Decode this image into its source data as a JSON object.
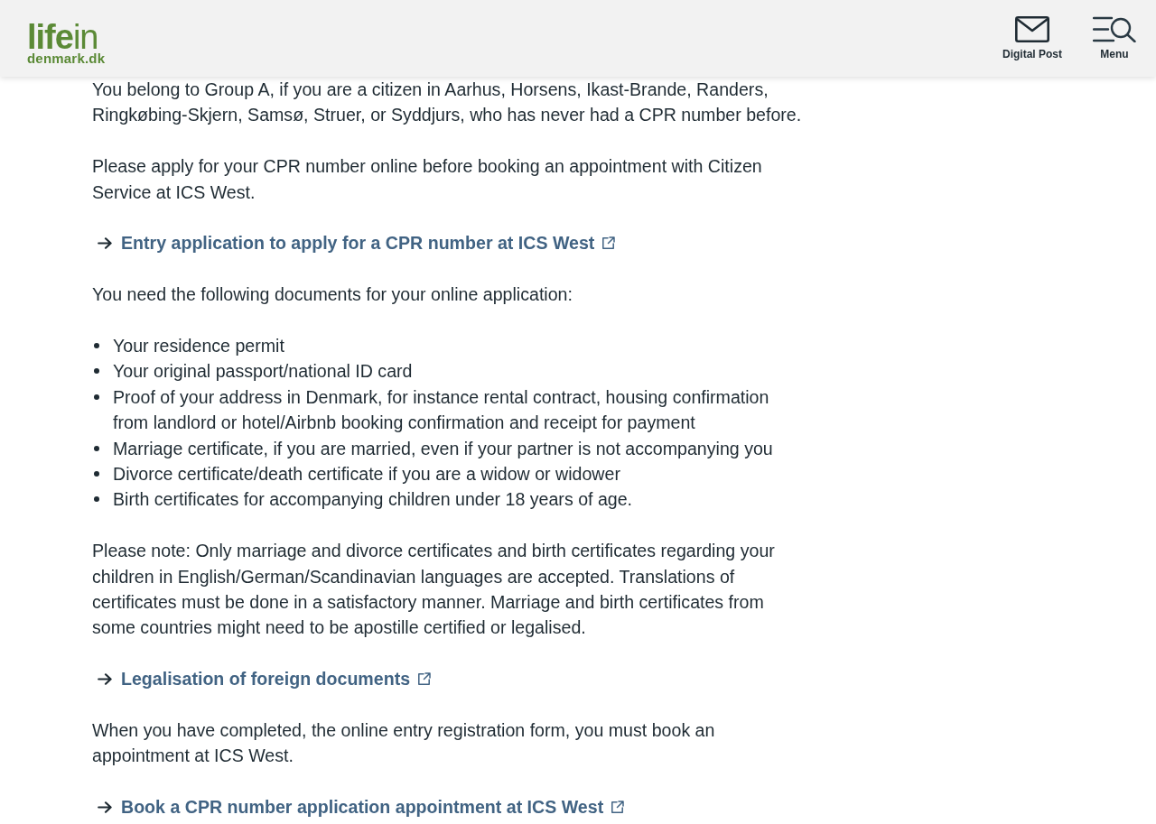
{
  "header": {
    "logo": {
      "wordmark": "**life**in",
      "domain": "denmark.dk"
    },
    "actions": [
      {
        "kind": "mail",
        "label": "Digital Post"
      },
      {
        "kind": "menu",
        "label": "Menu"
      }
    ]
  },
  "content": [
    {
      "kind": "paragraph",
      "text": "You belong to Group A, if you are a citizen in Aarhus, Horsens, Ikast-Brande, Randers, Ringkøbing-Skjern, Samsø, Struer, or Syddjurs, who has never had a CPR number before."
    },
    {
      "kind": "paragraph",
      "text": "Please apply for your CPR number online before booking an appointment with Citizen Service at ICS West."
    },
    {
      "kind": "link",
      "text": "Entry application to apply for a CPR number at ICS West",
      "external": true
    },
    {
      "kind": "paragraph",
      "text": "You need the following documents for your online application:"
    },
    {
      "kind": "list",
      "items": [
        "Your residence permit",
        "Your original passport/national ID card",
        "Proof of your address in Denmark, for instance rental contract, housing confirmation from landlord or hotel/Airbnb booking confirmation and receipt for payment",
        "Marriage certificate, if you are married, even if your partner is not accompanying you",
        "Divorce certificate/death certificate if you are a widow or widower",
        "Birth certificates for accompanying children under 18 years of age."
      ]
    },
    {
      "kind": "paragraph",
      "text": "Please note: Only marriage and divorce certificates and birth certificates regarding your children in English/German/Scandinavian languages are accepted. Translations of certificates must be done in a satisfactory manner. Marriage and birth certificates from some countries might need to be apostille certified or legalised."
    },
    {
      "kind": "link",
      "text": "Legalisation of foreign documents",
      "external": true
    },
    {
      "kind": "paragraph",
      "text": "When you have completed, the online entry registration form, you must book an appointment at ICS West."
    },
    {
      "kind": "link",
      "text": "Book a CPR number application appointment at ICS West",
      "external": true
    }
  ]
}
